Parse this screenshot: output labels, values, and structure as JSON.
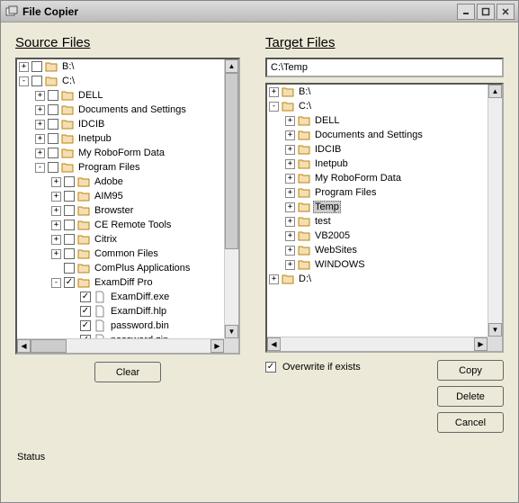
{
  "window": {
    "title": "File Copier"
  },
  "sections": {
    "source_title": "Source Files",
    "target_title": "Target Files"
  },
  "target_path": "C:\\Temp",
  "source_tree": [
    {
      "label": "B:\\",
      "exp": "+",
      "chk": ""
    },
    {
      "label": "C:\\",
      "exp": "-",
      "chk": "",
      "children": [
        {
          "label": "DELL",
          "exp": "+",
          "chk": ""
        },
        {
          "label": "Documents and Settings",
          "exp": "+",
          "chk": ""
        },
        {
          "label": "IDCIB",
          "exp": "+",
          "chk": ""
        },
        {
          "label": "Inetpub",
          "exp": "+",
          "chk": ""
        },
        {
          "label": "My RoboForm Data",
          "exp": "+",
          "chk": ""
        },
        {
          "label": "Program Files",
          "exp": "-",
          "chk": "",
          "children": [
            {
              "label": "Adobe",
              "exp": "+",
              "chk": ""
            },
            {
              "label": "AIM95",
              "exp": "+",
              "chk": ""
            },
            {
              "label": "Browster",
              "exp": "+",
              "chk": ""
            },
            {
              "label": "CE Remote Tools",
              "exp": "+",
              "chk": ""
            },
            {
              "label": "Citrix",
              "exp": "+",
              "chk": ""
            },
            {
              "label": "Common Files",
              "exp": "+",
              "chk": ""
            },
            {
              "label": "ComPlus Applications",
              "exp": " ",
              "chk": ""
            },
            {
              "label": "ExamDiff Pro",
              "exp": "-",
              "chk": "✓",
              "children": [
                {
                  "label": "ExamDiff.exe",
                  "exp": " ",
                  "chk": "✓",
                  "file": true
                },
                {
                  "label": "ExamDiff.hlp",
                  "exp": " ",
                  "chk": "✓",
                  "file": true
                },
                {
                  "label": "password.bin",
                  "exp": " ",
                  "chk": "✓",
                  "file": true
                },
                {
                  "label": "password.zip",
                  "exp": " ",
                  "chk": "✓",
                  "file": true
                }
              ]
            }
          ]
        }
      ]
    }
  ],
  "target_tree": [
    {
      "label": "B:\\",
      "exp": "+"
    },
    {
      "label": "C:\\",
      "exp": "-",
      "children": [
        {
          "label": "DELL",
          "exp": "+"
        },
        {
          "label": "Documents and Settings",
          "exp": "+"
        },
        {
          "label": "IDCIB",
          "exp": "+"
        },
        {
          "label": "Inetpub",
          "exp": "+"
        },
        {
          "label": "My RoboForm Data",
          "exp": "+"
        },
        {
          "label": "Program Files",
          "exp": "+"
        },
        {
          "label": "Temp",
          "exp": "+",
          "selected": true
        },
        {
          "label": "test",
          "exp": "+"
        },
        {
          "label": "VB2005",
          "exp": "+"
        },
        {
          "label": "WebSites",
          "exp": "+"
        },
        {
          "label": "WINDOWS",
          "exp": "+"
        }
      ]
    },
    {
      "label": "D:\\",
      "exp": "+"
    }
  ],
  "buttons": {
    "clear": "Clear",
    "copy": "Copy",
    "delete": "Delete",
    "cancel": "Cancel"
  },
  "overwrite": {
    "label": "Overwrite if exists",
    "checked": true
  },
  "status_label": "Status"
}
